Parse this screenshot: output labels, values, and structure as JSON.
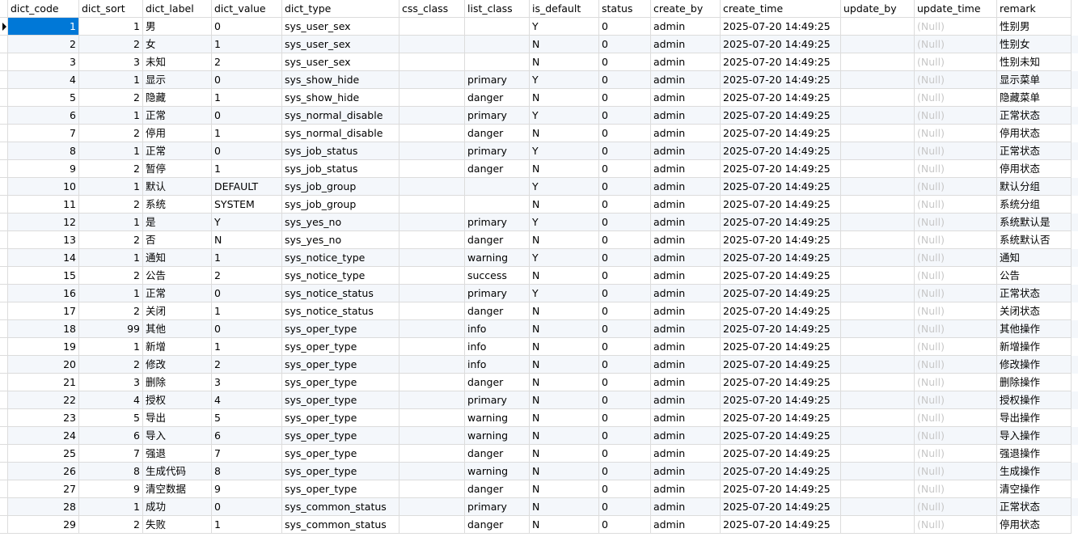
{
  "columns": [
    "dict_code",
    "dict_sort",
    "dict_label",
    "dict_value",
    "dict_type",
    "css_class",
    "list_class",
    "is_default",
    "status",
    "create_by",
    "create_time",
    "update_by",
    "update_time",
    "remark"
  ],
  "rows": [
    [
      "1",
      "1",
      "男",
      "0",
      "sys_user_sex",
      "",
      "",
      "Y",
      "0",
      "admin",
      "2025-07-20 14:49:25",
      "",
      "(Null)",
      "性别男"
    ],
    [
      "2",
      "2",
      "女",
      "1",
      "sys_user_sex",
      "",
      "",
      "N",
      "0",
      "admin",
      "2025-07-20 14:49:25",
      "",
      "(Null)",
      "性别女"
    ],
    [
      "3",
      "3",
      "未知",
      "2",
      "sys_user_sex",
      "",
      "",
      "N",
      "0",
      "admin",
      "2025-07-20 14:49:25",
      "",
      "(Null)",
      "性别未知"
    ],
    [
      "4",
      "1",
      "显示",
      "0",
      "sys_show_hide",
      "",
      "primary",
      "Y",
      "0",
      "admin",
      "2025-07-20 14:49:25",
      "",
      "(Null)",
      "显示菜单"
    ],
    [
      "5",
      "2",
      "隐藏",
      "1",
      "sys_show_hide",
      "",
      "danger",
      "N",
      "0",
      "admin",
      "2025-07-20 14:49:25",
      "",
      "(Null)",
      "隐藏菜单"
    ],
    [
      "6",
      "1",
      "正常",
      "0",
      "sys_normal_disable",
      "",
      "primary",
      "Y",
      "0",
      "admin",
      "2025-07-20 14:49:25",
      "",
      "(Null)",
      "正常状态"
    ],
    [
      "7",
      "2",
      "停用",
      "1",
      "sys_normal_disable",
      "",
      "danger",
      "N",
      "0",
      "admin",
      "2025-07-20 14:49:25",
      "",
      "(Null)",
      "停用状态"
    ],
    [
      "8",
      "1",
      "正常",
      "0",
      "sys_job_status",
      "",
      "primary",
      "Y",
      "0",
      "admin",
      "2025-07-20 14:49:25",
      "",
      "(Null)",
      "正常状态"
    ],
    [
      "9",
      "2",
      "暂停",
      "1",
      "sys_job_status",
      "",
      "danger",
      "N",
      "0",
      "admin",
      "2025-07-20 14:49:25",
      "",
      "(Null)",
      "停用状态"
    ],
    [
      "10",
      "1",
      "默认",
      "DEFAULT",
      "sys_job_group",
      "",
      "",
      "Y",
      "0",
      "admin",
      "2025-07-20 14:49:25",
      "",
      "(Null)",
      "默认分组"
    ],
    [
      "11",
      "2",
      "系统",
      "SYSTEM",
      "sys_job_group",
      "",
      "",
      "N",
      "0",
      "admin",
      "2025-07-20 14:49:25",
      "",
      "(Null)",
      "系统分组"
    ],
    [
      "12",
      "1",
      "是",
      "Y",
      "sys_yes_no",
      "",
      "primary",
      "Y",
      "0",
      "admin",
      "2025-07-20 14:49:25",
      "",
      "(Null)",
      "系统默认是"
    ],
    [
      "13",
      "2",
      "否",
      "N",
      "sys_yes_no",
      "",
      "danger",
      "N",
      "0",
      "admin",
      "2025-07-20 14:49:25",
      "",
      "(Null)",
      "系统默认否"
    ],
    [
      "14",
      "1",
      "通知",
      "1",
      "sys_notice_type",
      "",
      "warning",
      "Y",
      "0",
      "admin",
      "2025-07-20 14:49:25",
      "",
      "(Null)",
      "通知"
    ],
    [
      "15",
      "2",
      "公告",
      "2",
      "sys_notice_type",
      "",
      "success",
      "N",
      "0",
      "admin",
      "2025-07-20 14:49:25",
      "",
      "(Null)",
      "公告"
    ],
    [
      "16",
      "1",
      "正常",
      "0",
      "sys_notice_status",
      "",
      "primary",
      "Y",
      "0",
      "admin",
      "2025-07-20 14:49:25",
      "",
      "(Null)",
      "正常状态"
    ],
    [
      "17",
      "2",
      "关闭",
      "1",
      "sys_notice_status",
      "",
      "danger",
      "N",
      "0",
      "admin",
      "2025-07-20 14:49:25",
      "",
      "(Null)",
      "关闭状态"
    ],
    [
      "18",
      "99",
      "其他",
      "0",
      "sys_oper_type",
      "",
      "info",
      "N",
      "0",
      "admin",
      "2025-07-20 14:49:25",
      "",
      "(Null)",
      "其他操作"
    ],
    [
      "19",
      "1",
      "新增",
      "1",
      "sys_oper_type",
      "",
      "info",
      "N",
      "0",
      "admin",
      "2025-07-20 14:49:25",
      "",
      "(Null)",
      "新增操作"
    ],
    [
      "20",
      "2",
      "修改",
      "2",
      "sys_oper_type",
      "",
      "info",
      "N",
      "0",
      "admin",
      "2025-07-20 14:49:25",
      "",
      "(Null)",
      "修改操作"
    ],
    [
      "21",
      "3",
      "删除",
      "3",
      "sys_oper_type",
      "",
      "danger",
      "N",
      "0",
      "admin",
      "2025-07-20 14:49:25",
      "",
      "(Null)",
      "删除操作"
    ],
    [
      "22",
      "4",
      "授权",
      "4",
      "sys_oper_type",
      "",
      "primary",
      "N",
      "0",
      "admin",
      "2025-07-20 14:49:25",
      "",
      "(Null)",
      "授权操作"
    ],
    [
      "23",
      "5",
      "导出",
      "5",
      "sys_oper_type",
      "",
      "warning",
      "N",
      "0",
      "admin",
      "2025-07-20 14:49:25",
      "",
      "(Null)",
      "导出操作"
    ],
    [
      "24",
      "6",
      "导入",
      "6",
      "sys_oper_type",
      "",
      "warning",
      "N",
      "0",
      "admin",
      "2025-07-20 14:49:25",
      "",
      "(Null)",
      "导入操作"
    ],
    [
      "25",
      "7",
      "强退",
      "7",
      "sys_oper_type",
      "",
      "danger",
      "N",
      "0",
      "admin",
      "2025-07-20 14:49:25",
      "",
      "(Null)",
      "强退操作"
    ],
    [
      "26",
      "8",
      "生成代码",
      "8",
      "sys_oper_type",
      "",
      "warning",
      "N",
      "0",
      "admin",
      "2025-07-20 14:49:25",
      "",
      "(Null)",
      "生成操作"
    ],
    [
      "27",
      "9",
      "清空数据",
      "9",
      "sys_oper_type",
      "",
      "danger",
      "N",
      "0",
      "admin",
      "2025-07-20 14:49:25",
      "",
      "(Null)",
      "清空操作"
    ],
    [
      "28",
      "1",
      "成功",
      "0",
      "sys_common_status",
      "",
      "primary",
      "N",
      "0",
      "admin",
      "2025-07-20 14:49:25",
      "",
      "(Null)",
      "正常状态"
    ],
    [
      "29",
      "2",
      "失败",
      "1",
      "sys_common_status",
      "",
      "danger",
      "N",
      "0",
      "admin",
      "2025-07-20 14:49:25",
      "",
      "(Null)",
      "停用状态"
    ]
  ],
  "colors": {
    "selection": "#0078d7",
    "null_text": "#c8c8c8",
    "alt_row": "#f4f7fb",
    "grid_line": "#dcdcdc"
  }
}
